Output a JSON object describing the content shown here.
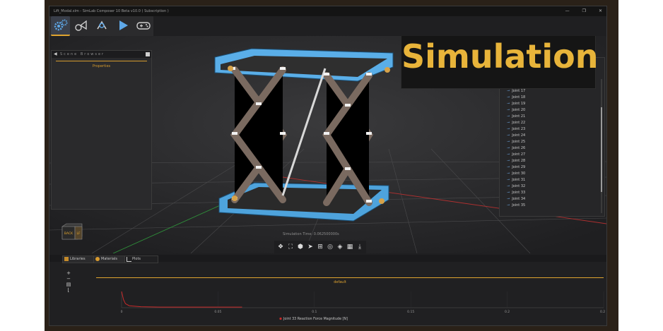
{
  "window": {
    "title": "Lift_Modal.slm - SimLab Composer 10 Beta v10.0 ( Subscription )",
    "controls": [
      "—",
      "❐",
      "✕"
    ]
  },
  "toolbar": {
    "tools": [
      {
        "name": "settings-gears-icon",
        "active": true
      },
      {
        "name": "joint-icon",
        "active": false
      },
      {
        "name": "motion-icon",
        "active": false
      },
      {
        "name": "play-icon",
        "active": false
      },
      {
        "name": "gamepad-icon",
        "active": false
      }
    ]
  },
  "scene_browser": {
    "title": "Scene Browser",
    "properties_label": "Properties"
  },
  "joints": {
    "items": [
      "Joint 16",
      "Joint 17",
      "Joint 18",
      "Joint 19",
      "Joint 20",
      "Joint 21",
      "Joint 22",
      "Joint 23",
      "Joint 24",
      "Joint 25",
      "Joint 26",
      "Joint 27",
      "Joint 28",
      "Joint 29",
      "Joint 30",
      "Joint 31",
      "Joint 32",
      "Joint 33",
      "Joint 34",
      "Joint 35"
    ]
  },
  "overlay": {
    "text": "Simulation"
  },
  "viewport": {
    "sim_time": "Simulation Time: 0.062500000s",
    "nav_cube": {
      "back": "BACK",
      "left": "LF"
    }
  },
  "bottom": {
    "tabs": [
      "Libraries",
      "Materials",
      "Plots"
    ],
    "side_tools": [
      "+",
      "−"
    ]
  },
  "plot": {
    "title": "default",
    "legend": "Joint 33 Reaction Force Magnitude [N]"
  },
  "chart_data": {
    "type": "line",
    "title": "default",
    "x_ticks": [
      "0",
      "0.05",
      "0.1",
      "0.15",
      "0.2",
      "0.25"
    ],
    "xlim": [
      0,
      0.25
    ],
    "series": [
      {
        "name": "Joint 33 Reaction Force Magnitude [N]",
        "x": [
          0,
          0.001,
          0.002,
          0.004,
          0.01,
          0.02,
          0.04,
          0.0625
        ],
        "y": [
          1,
          0.5,
          0.25,
          0.12,
          0.06,
          0.04,
          0.04,
          0.04
        ]
      }
    ],
    "ylim": [
      0,
      1
    ],
    "color": "#c92a2a",
    "grid": true
  },
  "colors": {
    "accent": "#e0a42f",
    "lift_blue": "#5aaee8"
  }
}
